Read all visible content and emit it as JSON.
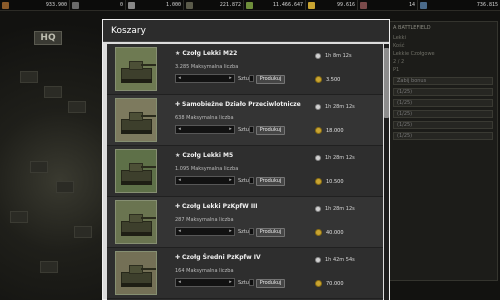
{
  "topbar": {
    "resources": [
      {
        "icon": "fuel-icon",
        "value": "933.900",
        "color": "#8a5a2a"
      },
      {
        "icon": "oil-icon",
        "value": "0",
        "color": "#6a6a6a"
      },
      {
        "icon": "steel-icon",
        "value": "1.000",
        "color": "#888888"
      },
      {
        "icon": "rubber-icon",
        "value": "221.872",
        "color": "#5a5a4a"
      },
      {
        "icon": "money-icon",
        "value": "11.466.647",
        "color": "#6e8e3a"
      },
      {
        "icon": "gold-icon",
        "value": "99.616",
        "color": "#c9a431"
      },
      {
        "icon": "ammo-icon",
        "value": "14",
        "color": "#7a4a4a"
      },
      {
        "icon": "score-icon",
        "value": "736.815",
        "color": "#4a6a8a"
      }
    ]
  },
  "background": {
    "hq_label": "HQ",
    "right_panel": {
      "title": "A BATTLEFIELD",
      "lines": [
        "Lekki",
        "Kość",
        "Lekkie Czołgowe",
        "2 / 2",
        "P1"
      ],
      "bars": [
        "Zabij bonus",
        "(1/25)",
        "(1/25)",
        "(1/25)",
        "(1/25)",
        "(1/25)"
      ]
    }
  },
  "dialog": {
    "title": "Koszary",
    "units": [
      {
        "name": "Czołg Lekki M22",
        "symbol": "★",
        "max_text": "3.285 Maksymalna liczba",
        "time": "1h 8m 12s",
        "cost": "3.500",
        "sztuk_label": "Sztuk",
        "button_label": "Produkuj",
        "thumb_color": "#6e7a52"
      },
      {
        "name": "Samobieżne Działo Przeciwlotnicze",
        "symbol": "✚",
        "max_text": "638 Maksymalna liczba",
        "time": "1h 28m 12s",
        "cost": "18.000",
        "sztuk_label": "Sztuk",
        "button_label": "Produkuj",
        "thumb_color": "#7d7a5e"
      },
      {
        "name": "Czołg Lekki M5",
        "symbol": "★",
        "max_text": "1.095 Maksymalna liczba",
        "time": "1h 28m 12s",
        "cost": "10.500",
        "sztuk_label": "Sztuk",
        "button_label": "Produkuj",
        "thumb_color": "#5e7048"
      },
      {
        "name": "Czołg Lekki PzKpfW III",
        "symbol": "✚",
        "max_text": "287 Maksymalna liczba",
        "time": "1h 28m 12s",
        "cost": "40.000",
        "sztuk_label": "Sztuk",
        "button_label": "Produkuj",
        "thumb_color": "#6a7450"
      },
      {
        "name": "Czołg Średni PzKpfw IV",
        "symbol": "✚",
        "max_text": "164 Maksymalna liczba",
        "time": "1h 42m 54s",
        "cost": "70.000",
        "sztuk_label": "Sztuk",
        "button_label": "Produkuj",
        "thumb_color": "#747056"
      }
    ]
  }
}
